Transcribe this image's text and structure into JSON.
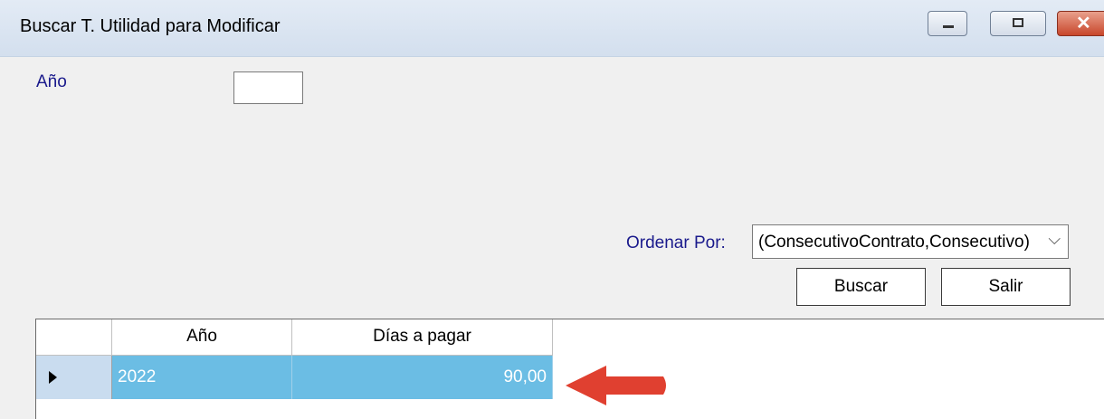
{
  "window": {
    "title": "Buscar T. Utilidad para Modificar",
    "controls": {
      "minimize": "minimize-icon",
      "maximize": "maximize-icon",
      "close": "close-icon"
    }
  },
  "filters": {
    "anio_label": "Año",
    "anio_value": ""
  },
  "order": {
    "label": "Ordenar Por:",
    "selected": "(ConsecutivoContrato,Consecutivo)"
  },
  "buttons": {
    "buscar": "Buscar",
    "salir": "Salir"
  },
  "grid": {
    "columns": [
      "Año",
      "Días a pagar"
    ],
    "rows": [
      {
        "anio": "2022",
        "dias": "90,00"
      }
    ]
  },
  "colors": {
    "selection": "#6bbde4",
    "label_text": "#1a1a8c",
    "arrow": "#e04030"
  }
}
